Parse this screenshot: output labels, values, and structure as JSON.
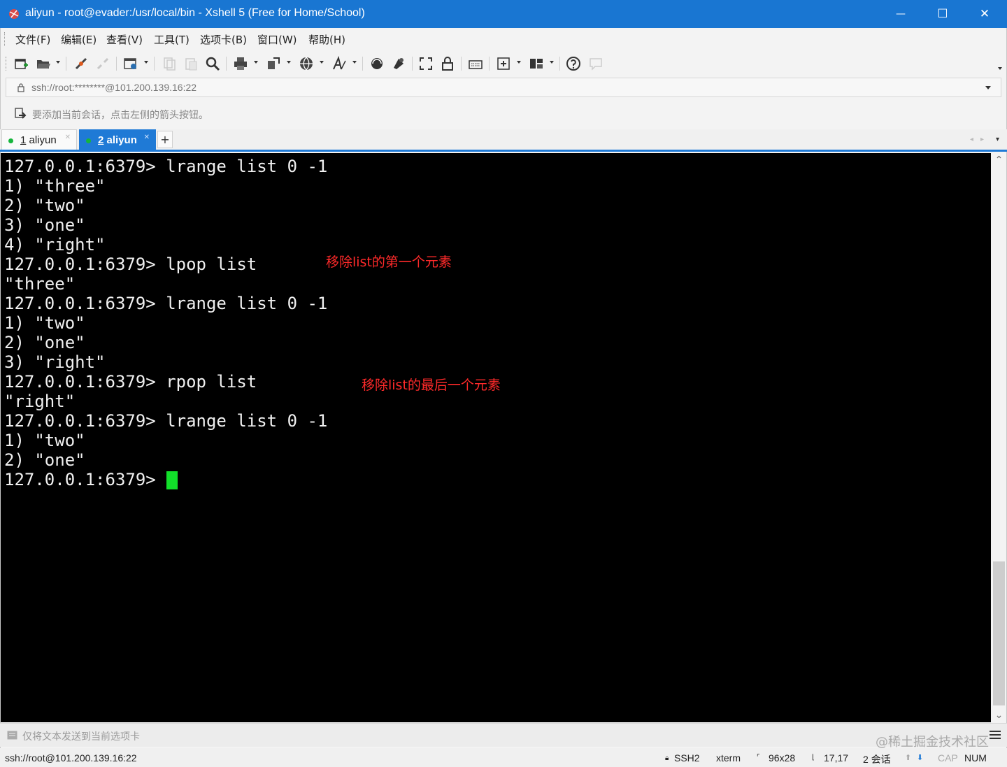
{
  "window": {
    "title": "aliyun - root@evader:/usr/local/bin - Xshell 5 (Free for Home/School)",
    "minimize_glyph": "—",
    "maximize_glyph": "☐",
    "close_glyph": "✕",
    "accent_color": "#1976d2"
  },
  "menu": {
    "file": "文件(F)",
    "edit": "编辑(E)",
    "view": "查看(V)",
    "tools": "工具(T)",
    "tabs": "选项卡(B)",
    "window": "窗口(W)",
    "help": "帮助(H)"
  },
  "toolbar": {
    "icons": [
      "new-session-icon",
      "open-folder-icon",
      "reconnect-icon",
      "disconnect-icon",
      "properties-icon",
      "copy-icon",
      "paste-icon",
      "find-icon",
      "print-icon",
      "transfer-icon",
      "globe-icon",
      "font-icon",
      "xftp-icon",
      "xmanager-icon",
      "fullscreen-icon",
      "lock-icon",
      "keyboard-icon",
      "new-tab-icon",
      "layout-icon",
      "help-icon",
      "chat-icon"
    ]
  },
  "address": {
    "value": "ssh://root:********@101.200.139.16:22"
  },
  "hint": {
    "text": "要添加当前会话，点击左侧的箭头按钮。"
  },
  "tabs": [
    {
      "number": "1",
      "name": " aliyun",
      "active": false
    },
    {
      "number": "2",
      "name": " aliyun",
      "active": true
    }
  ],
  "tab_controls": {
    "add": "+",
    "prev": "◂",
    "next": "▸",
    "menu": "▾"
  },
  "terminal": {
    "lines": [
      "127.0.0.1:6379> lrange list 0 -1",
      "1) \"three\"",
      "2) \"two\"",
      "3) \"one\"",
      "4) \"right\"",
      "127.0.0.1:6379> lpop list",
      "\"three\"",
      "127.0.0.1:6379> lrange list 0 -1",
      "1) \"two\"",
      "2) \"one\"",
      "3) \"right\"",
      "127.0.0.1:6379> rpop list",
      "\"right\"",
      "127.0.0.1:6379> lrange list 0 -1",
      "1) \"two\"",
      "2) \"one\"",
      "127.0.0.1:6379> "
    ],
    "annotations": [
      "移除list的第一个元素",
      "移除list的最后一个元素"
    ],
    "cursor_color": "#12e02a"
  },
  "scrollbar": {
    "up": "⌃",
    "down": "⌄"
  },
  "sendbar": {
    "text": "仅将文本发送到当前选项卡",
    "watermark": "@稀土掘金技术社区"
  },
  "status": {
    "address": "ssh://root@101.200.139.16:22",
    "protocol": "SSH2",
    "terminal_type": "xterm",
    "size": "96x28",
    "position": "17,17",
    "sessions": "2 会话",
    "up_arrow": "⬆",
    "down_arrow": "⬇",
    "cap": "CAP",
    "num": "NUM"
  }
}
